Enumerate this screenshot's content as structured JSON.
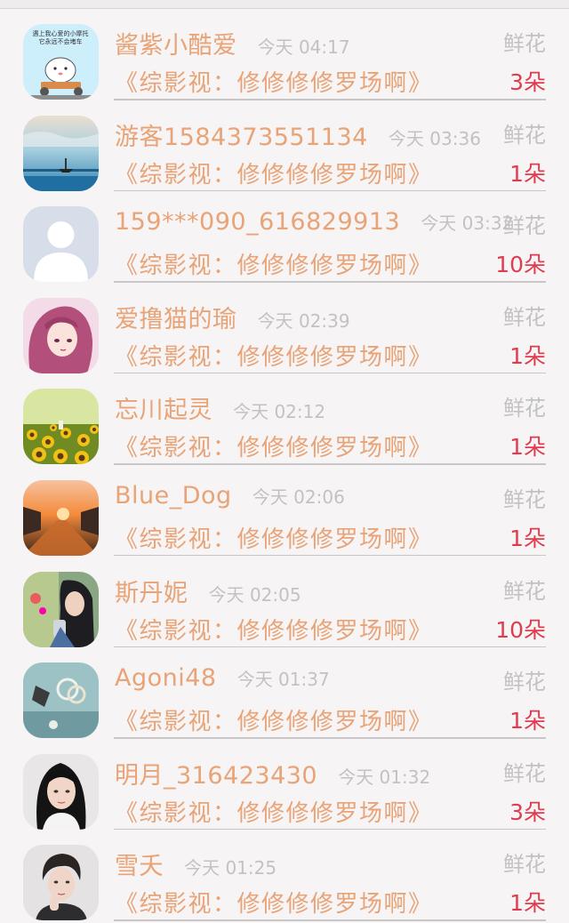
{
  "rows": [
    {
      "nickname": "酱紫小酷爱",
      "time": "今天 04:17",
      "gift": "鲜花",
      "book": "《综影视：修修修修罗场啊》",
      "count": "3朵",
      "avatar_bg": "#cdeefb",
      "avatar_text_1": "遇上我心爱的小摩托",
      "avatar_text_2": "它永远不会堵车"
    },
    {
      "nickname": "游客1584373551134",
      "time": "今天 03:36",
      "gift": "鲜花",
      "book": "《综影视：修修修修罗场啊》",
      "count": "1朵",
      "avatar_bg": "#8fc5df"
    },
    {
      "nickname": "159***090_616829913",
      "time": "今天 03:32",
      "gift": "鲜花",
      "book": "《综影视：修修修修罗场啊》",
      "count": "10朵",
      "avatar_bg": "#d7deea"
    },
    {
      "nickname": "爱撸猫的瑜",
      "time": "今天 02:39",
      "gift": "鲜花",
      "book": "《综影视：修修修修罗场啊》",
      "count": "1朵",
      "avatar_bg": "#f3dbe8"
    },
    {
      "nickname": "忘川起灵",
      "time": "今天 02:12",
      "gift": "鲜花",
      "book": "《综影视：修修修修罗场啊》",
      "count": "1朵",
      "avatar_bg": "#c9d98a"
    },
    {
      "nickname": "Blue_Dog",
      "time": "今天 02:06",
      "gift": "鲜花",
      "book": "《综影视：修修修修罗场啊》",
      "count": "1朵",
      "avatar_bg": "#7a4c3a"
    },
    {
      "nickname": "斯丹妮",
      "time": "今天 02:05",
      "gift": "鲜花",
      "book": "《综影视：修修修修罗场啊》",
      "count": "10朵",
      "avatar_bg": "#8aa784"
    },
    {
      "nickname": "Agoni48",
      "time": "今天 01:37",
      "gift": "鲜花",
      "book": "《综影视：修修修修罗场啊》",
      "count": "1朵",
      "avatar_bg": "#9cc2c5"
    },
    {
      "nickname": "明月_316423430",
      "time": "今天 01:32",
      "gift": "鲜花",
      "book": "《综影视：修修修修罗场啊》",
      "count": "3朵",
      "avatar_bg": "#e8e6e6"
    },
    {
      "nickname": "雪夭",
      "time": "今天 01:25",
      "gift": "鲜花",
      "book": "《综影视：修修修修罗场啊》",
      "count": "1朵",
      "avatar_bg": "#e4e2e3"
    }
  ]
}
